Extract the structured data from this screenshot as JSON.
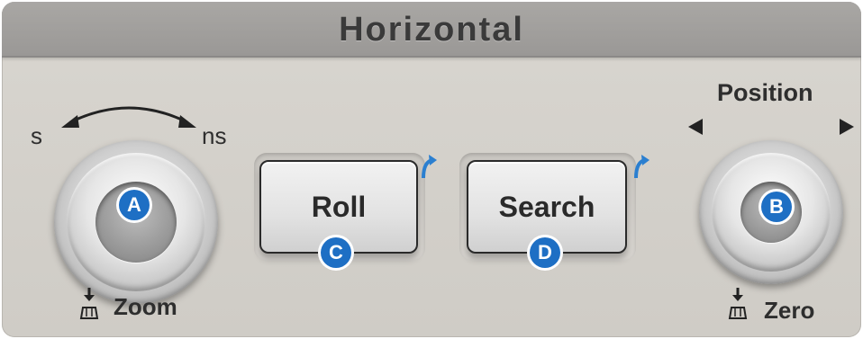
{
  "panel": {
    "title": "Horizontal"
  },
  "scale_knob": {
    "left_label": "s",
    "right_label": "ns",
    "badge": "A",
    "push_label": "Zoom"
  },
  "buttons": {
    "roll": {
      "label": "Roll",
      "badge": "C"
    },
    "search": {
      "label": "Search",
      "badge": "D"
    }
  },
  "position_knob": {
    "label": "Position",
    "badge": "B",
    "push_label": "Zero"
  },
  "icons": {
    "rotate_arrow": "double-headed-arc-arrow-icon",
    "push": "push-knob-icon",
    "shift_indicator": "blue-shift-arrow-icon",
    "left": "triangle-left-icon",
    "right": "triangle-right-icon"
  },
  "colors": {
    "badge": "#1e6fc4",
    "shift_indicator": "#2b7fd0",
    "title_bar": "#a2a09d",
    "panel": "#d6d3cd"
  }
}
